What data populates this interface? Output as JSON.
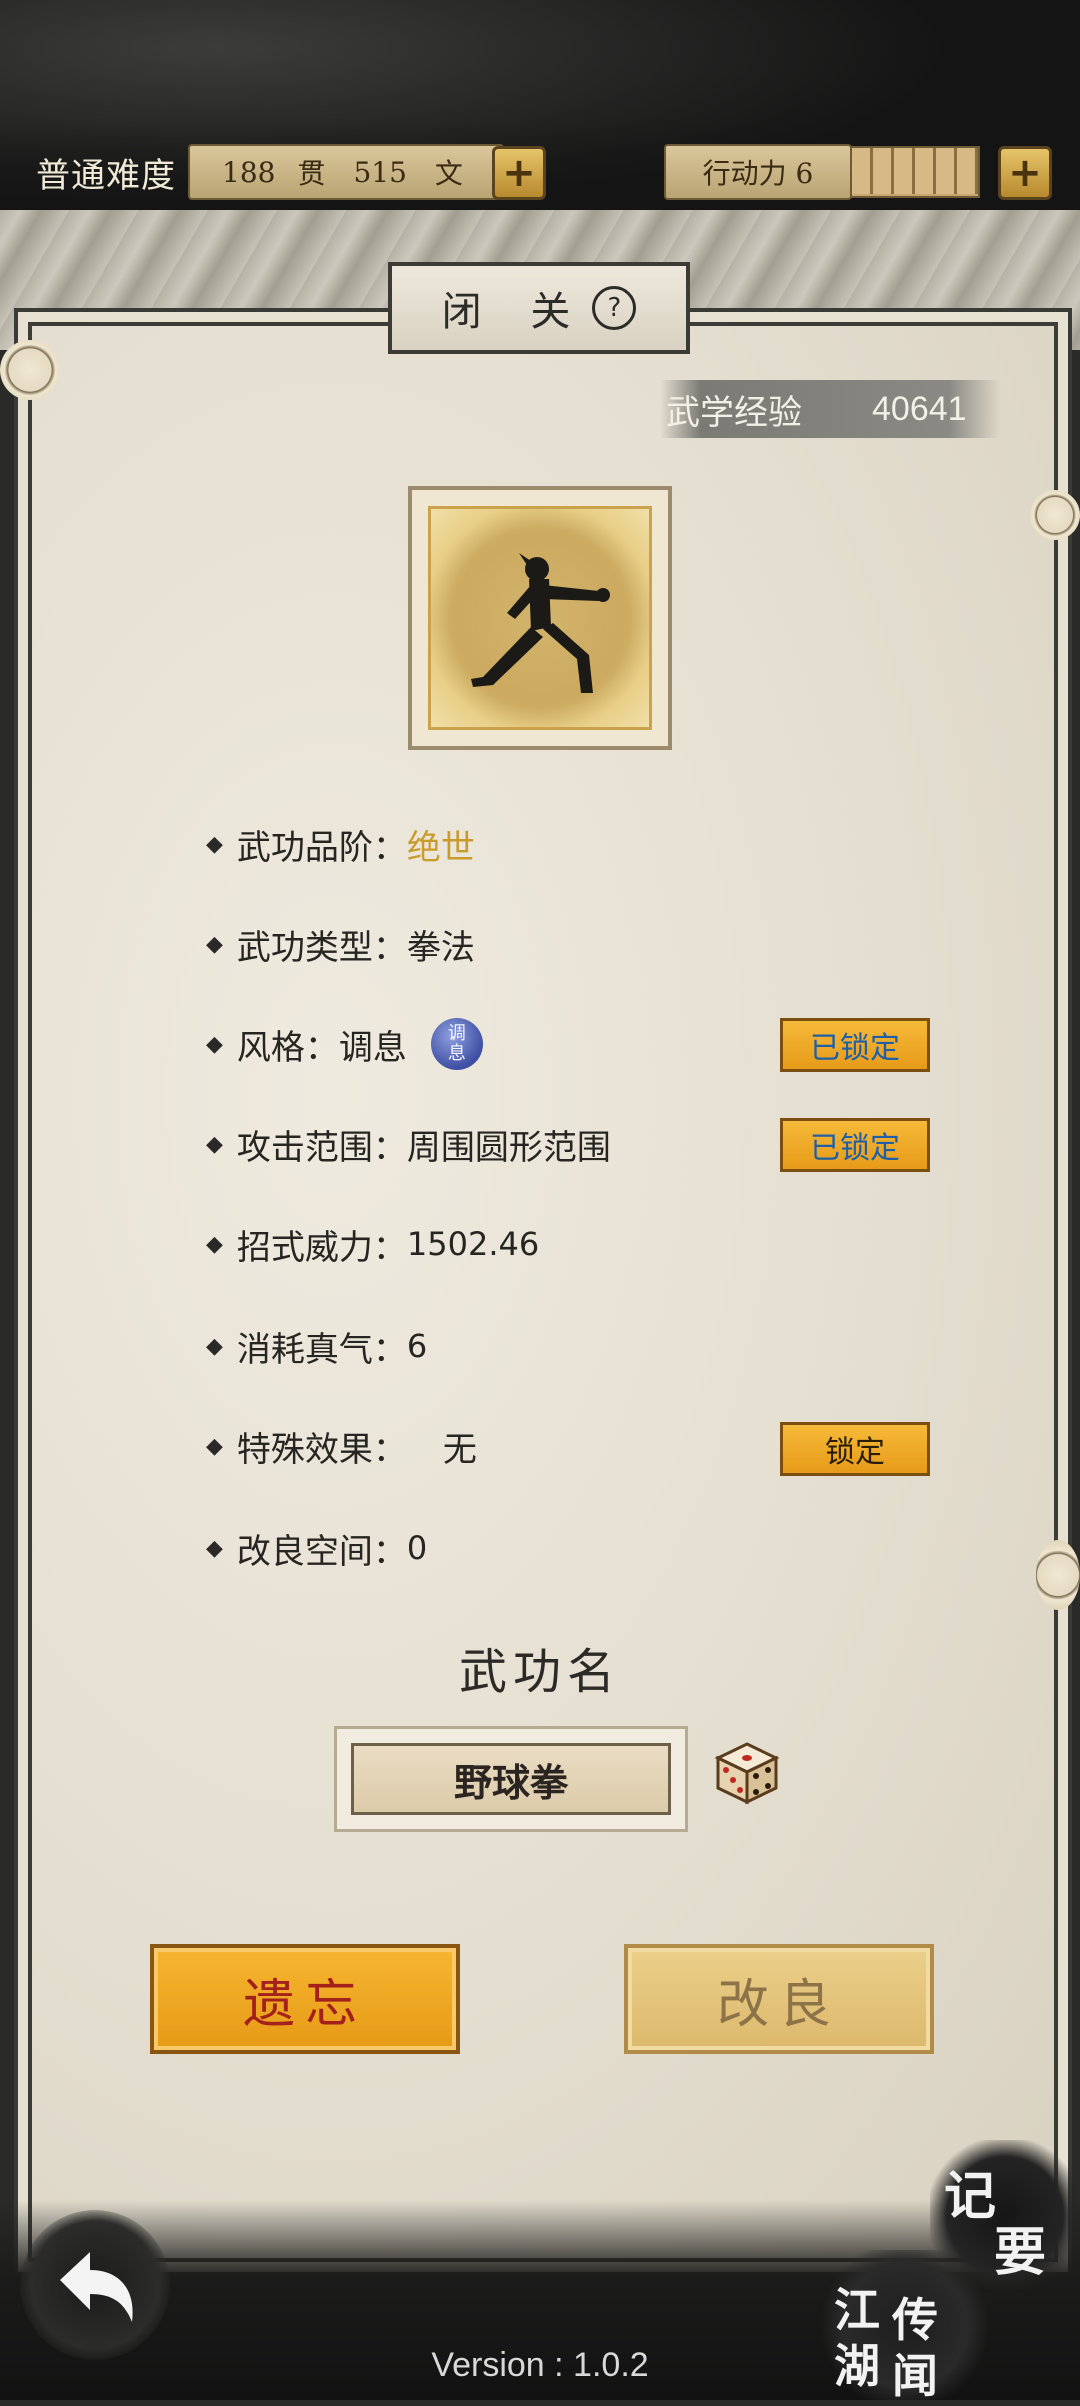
{
  "hud": {
    "difficulty": "普通难度",
    "money_guan_value": "188",
    "money_guan_unit": "贯",
    "money_wen_value": "515",
    "money_wen_unit": "文",
    "action_label": "行动力 6"
  },
  "panel": {
    "title": "闭 关",
    "exp_label": "武学经验",
    "exp_value": "40641"
  },
  "attributes": {
    "grade_label": "武功品阶：",
    "grade_value": "绝世",
    "type_label": "武功类型：",
    "type_value": "拳法",
    "style_label": "风格：",
    "style_value": "调息",
    "style_badge_top": "调",
    "style_badge_bottom": "息",
    "range_label": "攻击范围：",
    "range_value": "周围圆形范围",
    "power_label": "招式威力：",
    "power_value": "1502.46",
    "cost_label": "消耗真气：",
    "cost_value": "6",
    "effect_label": "特殊效果：",
    "effect_value": "无",
    "refine_label": "改良空间：",
    "refine_value": "0"
  },
  "buttons": {
    "style_lock": "已锁定",
    "range_lock": "已锁定",
    "effect_lock": "锁定",
    "forget": "遗忘",
    "improve": "改良"
  },
  "name_section": {
    "title": "武功名",
    "name_value": "野球拳"
  },
  "corner_buttons": {
    "notes_top": "记",
    "notes_bottom": "要",
    "rumor_1": "江",
    "rumor_2": "传",
    "rumor_3": "湖",
    "rumor_4": "闻"
  },
  "footer": {
    "version": "Version : 1.0.2"
  },
  "colors": {
    "gold_text": "#c89b2c",
    "lock_button": "#f0aa2a",
    "forget_text": "#a4201b",
    "board_bg": "#e6e0d2"
  },
  "icons": {
    "help": "question-circle-icon",
    "dice": "dice-icon",
    "back": "back-arrow-icon",
    "plus": "plus-icon"
  }
}
